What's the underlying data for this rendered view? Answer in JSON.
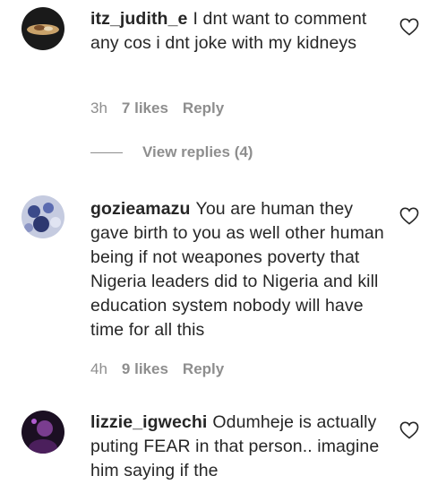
{
  "comments": [
    {
      "username": "itz_judith_e",
      "text": "I dnt want to comment any cos i dnt joke with my kidneys",
      "time": "3h",
      "likes": "7 likes",
      "reply_label": "Reply",
      "view_replies": "View replies (4)"
    },
    {
      "username": "gozieamazu",
      "text": "You are human they gave birth to you as well other human being if not weapones poverty that Nigeria leaders did to Nigeria and kill education system nobody will have time for all this",
      "time": "4h",
      "likes": "9 likes",
      "reply_label": "Reply"
    },
    {
      "username": "lizzie_igwechi",
      "text": "Odumheje is actually puting FEAR in that person.. imagine him saying if the"
    }
  ],
  "icons": {
    "like": "heart-outline-icon"
  },
  "colors": {
    "text": "#262626",
    "secondary": "#8e8e8e"
  }
}
